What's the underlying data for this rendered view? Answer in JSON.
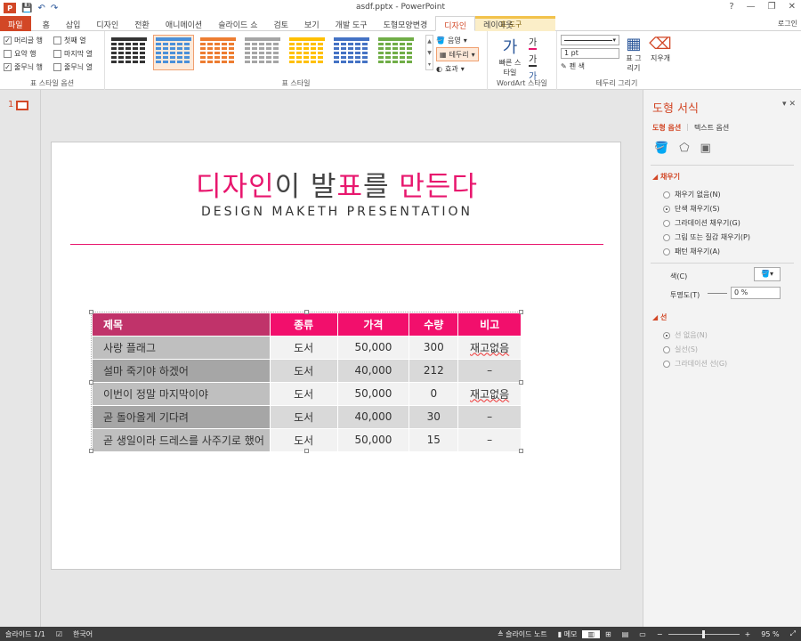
{
  "titlebar": {
    "title": "asdf.pptx - PowerPoint",
    "logo": "P",
    "undo": "↶",
    "redo": "↷",
    "save": "💾",
    "help": "?",
    "minimize": "—",
    "restore": "❐",
    "close": "✕"
  },
  "context_tab_header": "표 도구",
  "tabs": [
    "파일",
    "홈",
    "삽입",
    "디자인",
    "전환",
    "애니메이션",
    "슬라이드 쇼",
    "검토",
    "보기",
    "개발 도구",
    "도형모양변경",
    "디자인",
    "레이아웃"
  ],
  "login": "로그인",
  "ribbon": {
    "style_options": {
      "label": "표 스타일 옵션",
      "items": [
        {
          "label": "머리글 행",
          "checked": true
        },
        {
          "label": "첫째 열",
          "checked": false
        },
        {
          "label": "요약 행",
          "checked": false
        },
        {
          "label": "마지막 열",
          "checked": false
        },
        {
          "label": "줄무늬 행",
          "checked": true
        },
        {
          "label": "줄무늬 열",
          "checked": false
        }
      ]
    },
    "table_styles": {
      "label": "표 스타일",
      "colors": [
        "#333333",
        "#4a90d9",
        "#ed7d31",
        "#a5a5a5",
        "#ffc000",
        "#4472c4",
        "#70ad47"
      ],
      "shading": "음영",
      "border": "테두리",
      "effects": "효과"
    },
    "wordart": {
      "label": "WordArt 스타일",
      "quick": "빠른 스타일"
    },
    "draw_borders": {
      "label": "테두리 그리기",
      "pen_weight": "1 pt",
      "pen_color": "펜 색",
      "draw_table": "표 그리기",
      "eraser": "지우개"
    }
  },
  "slide_panel": {
    "number": "1"
  },
  "slide": {
    "title_parts": [
      {
        "text": "디자인",
        "accent": true
      },
      {
        "text": "이 발",
        "accent": false
      },
      {
        "text": "표",
        "accent": true
      },
      {
        "text": "를 ",
        "accent": false
      },
      {
        "text": "만든다",
        "accent": true
      }
    ],
    "subtitle": "DESIGN MAKETH PRESENTATION",
    "table": {
      "headers": [
        "제목",
        "종류",
        "가격",
        "수량",
        "비고"
      ],
      "rows": [
        [
          "사랑 플래그",
          "도서",
          "50,000",
          "300",
          "재고없음"
        ],
        [
          "설마 죽기야 하겠어",
          "도서",
          "40,000",
          "212",
          "–"
        ],
        [
          "이번이 정말 마지막이야",
          "도서",
          "50,000",
          "0",
          "재고없음"
        ],
        [
          "곧 돌아올게 기다려",
          "도서",
          "40,000",
          "30",
          "–"
        ],
        [
          "곧 생일이라 드레스를 사주기로 했어",
          "도서",
          "50,000",
          "15",
          "–"
        ]
      ]
    }
  },
  "format_pane": {
    "title": "도형 서식",
    "tab_shape": "도형 옵션",
    "tab_text": "텍스트 옵션",
    "fill_section": "채우기",
    "fill_options": [
      {
        "label": "채우기 없음(N)",
        "selected": false
      },
      {
        "label": "단색 채우기(S)",
        "selected": true
      },
      {
        "label": "그라데이션 채우기(G)",
        "selected": false
      },
      {
        "label": "그림 또는 질감 채우기(P)",
        "selected": false
      },
      {
        "label": "패턴 채우기(A)",
        "selected": false
      }
    ],
    "color_label": "색(C)",
    "transparency_label": "투명도(T)",
    "transparency_value": "0 %",
    "line_section": "선",
    "line_options": [
      {
        "label": "선 없음(N)",
        "selected": true
      },
      {
        "label": "실선(S)",
        "selected": false
      },
      {
        "label": "그라데이션 선(G)",
        "selected": false
      }
    ]
  },
  "statusbar": {
    "slide": "슬라이드 1/1",
    "language": "한국어",
    "notes": "슬라이드 노트",
    "comments": "메모",
    "zoom_minus": "−",
    "zoom_plus": "+",
    "zoom": "95 %"
  }
}
